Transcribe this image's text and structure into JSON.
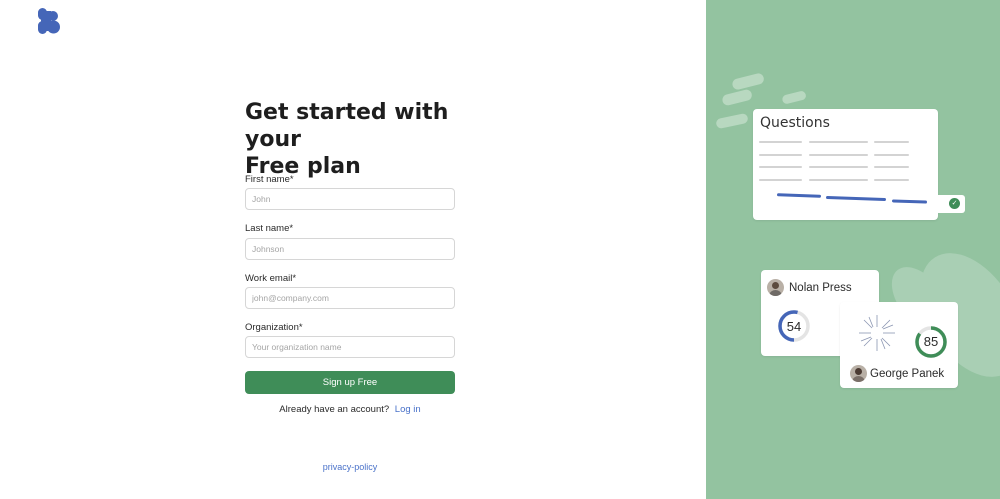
{
  "brand": {
    "logo_icon": "brand-logo-icon",
    "logo_color": "#4566b8"
  },
  "signup": {
    "title_line1": "Get started with your",
    "title_line2": "Free plan",
    "fields": [
      {
        "label": "First name*",
        "placeholder": "John"
      },
      {
        "label": "Last name*",
        "placeholder": "Johnson"
      },
      {
        "label": "Work email*",
        "placeholder": "john@company.com"
      },
      {
        "label": "Organization*",
        "placeholder": "Your organization name"
      }
    ],
    "submit_label": "Sign up Free",
    "login_prompt": "Already have an account?",
    "login_link": "Log in",
    "privacy_link": "privacy-policy",
    "accent_color": "#3f8d58",
    "link_color": "#4a72c9"
  },
  "illustration": {
    "background": "#93c3a0",
    "questions_title": "Questions",
    "person1": {
      "name": "Nolan Press",
      "score": "54"
    },
    "person2": {
      "name": "George Panek",
      "score": "85"
    }
  }
}
